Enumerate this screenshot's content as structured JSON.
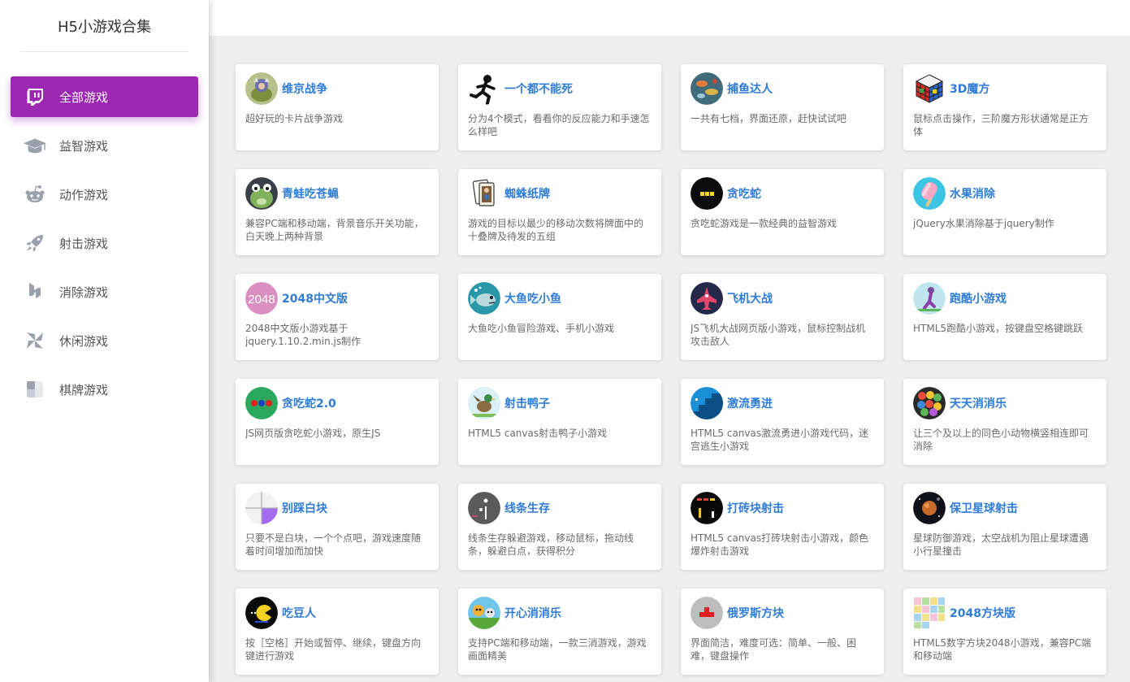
{
  "app": {
    "title": "H5小游戏合集"
  },
  "sidebar": {
    "items": [
      {
        "label": "全部游戏",
        "icon": "twitch-icon",
        "active": true
      },
      {
        "label": "益智游戏",
        "icon": "graduation-cap-icon",
        "active": false
      },
      {
        "label": "动作游戏",
        "icon": "reddit-alien-icon",
        "active": false
      },
      {
        "label": "射击游戏",
        "icon": "rocket-icon",
        "active": false
      },
      {
        "label": "消除游戏",
        "icon": "houzz-icon",
        "active": false
      },
      {
        "label": "休闲游戏",
        "icon": "pinwheel-icon",
        "active": false
      },
      {
        "label": "棋牌游戏",
        "icon": "checkerboard-icon",
        "active": false
      }
    ]
  },
  "colors": {
    "accent": "#9c27b0",
    "title_link": "#2f7cd7",
    "background": "#eeeeee"
  },
  "games": [
    {
      "title": "维京战争",
      "desc": "超好玩的卡片战争游戏",
      "thumb": "viking-thumb"
    },
    {
      "title": "一个都不能死",
      "desc": "分为4个模式，看看你的反应能力和手速怎么样吧",
      "thumb": "runner-thumb"
    },
    {
      "title": "捕鱼达人",
      "desc": "一共有七档，界面还原，赶快试试吧",
      "thumb": "fish-thumb"
    },
    {
      "title": "3D魔方",
      "desc": "鼠标点击操作，三阶魔方形状通常是正方体",
      "thumb": "rubiks-cube-thumb"
    },
    {
      "title": "青蛙吃苍蝇",
      "desc": "兼容PC端和移动端，背景音乐开关功能，白天晚上两种背景",
      "thumb": "frog-thumb"
    },
    {
      "title": "蜘蛛纸牌",
      "desc": "游戏的目标以最少的移动次数将牌面中的十叠牌及待发的五组",
      "thumb": "cards-thumb"
    },
    {
      "title": "贪吃蛇",
      "desc": "贪吃蛇游戏是一款经典的益智游戏",
      "thumb": "snake-thumb"
    },
    {
      "title": "水果消除",
      "desc": "jQuery水果消除基于jquery制作",
      "thumb": "popsicle-thumb"
    },
    {
      "title": "2048中文版",
      "desc": "2048中文版小游戏基于jquery.1.10.2.min.js制作",
      "thumb": "2048-thumb"
    },
    {
      "title": "大鱼吃小鱼",
      "desc": "大鱼吃小鱼冒险游戏、手机小游戏",
      "thumb": "bigfish-thumb"
    },
    {
      "title": "飞机大战",
      "desc": "JS飞机大战网页版小游戏，鼠标控制战机攻击敌人",
      "thumb": "plane-thumb"
    },
    {
      "title": "跑酷小游戏",
      "desc": "HTML5跑酷小游戏，按键盘空格键跳跃",
      "thumb": "parkour-thumb"
    },
    {
      "title": "贪吃蛇2.0",
      "desc": "JS网页版贪吃蛇小游戏，原生JS",
      "thumb": "snake2-thumb"
    },
    {
      "title": "射击鸭子",
      "desc": "HTML5 canvas射击鸭子小游戏",
      "thumb": "duck-thumb"
    },
    {
      "title": "激流勇进",
      "desc": "HTML5 canvas激流勇进小游戏代码，迷宫逃生小游戏",
      "thumb": "stairs-thumb"
    },
    {
      "title": "天天消消乐",
      "desc": "让三个及以上的同色小动物横竖相连即可消除",
      "thumb": "match3-thumb"
    },
    {
      "title": "别踩白块",
      "desc": "只要不是白块，一个个点吧，游戏速度随着时间增加而加快",
      "thumb": "tiles-thumb"
    },
    {
      "title": "线条生存",
      "desc": "线条生存躲避游戏，移动鼠标，拖动线条，躲避白点，获得积分",
      "thumb": "line-thumb"
    },
    {
      "title": "打砖块射击",
      "desc": "HTML5 canvas打砖块射击小游戏，颜色爆炸射击游戏",
      "thumb": "bricks-thumb"
    },
    {
      "title": "保卫星球射击",
      "desc": "星球防御游戏，太空战机为阻止星球遭遇小行星撞击",
      "thumb": "planet-thumb"
    },
    {
      "title": "吃豆人",
      "desc": "按［空格］开始或暂停、继续，键盘方向键进行游戏",
      "thumb": "pacman-thumb"
    },
    {
      "title": "开心消消乐",
      "desc": "支持PC端和移动端，一款三消游戏，游戏画面精美",
      "thumb": "happy-match-thumb"
    },
    {
      "title": "俄罗斯方块",
      "desc": "界面简洁，难度可选：简单、一般、困难，键盘操作",
      "thumb": "tetris-thumb"
    },
    {
      "title": "2048方块版",
      "desc": "HTML5数字方块2048小游戏，兼容PC端和移动端",
      "thumb": "2048-block-thumb"
    }
  ]
}
